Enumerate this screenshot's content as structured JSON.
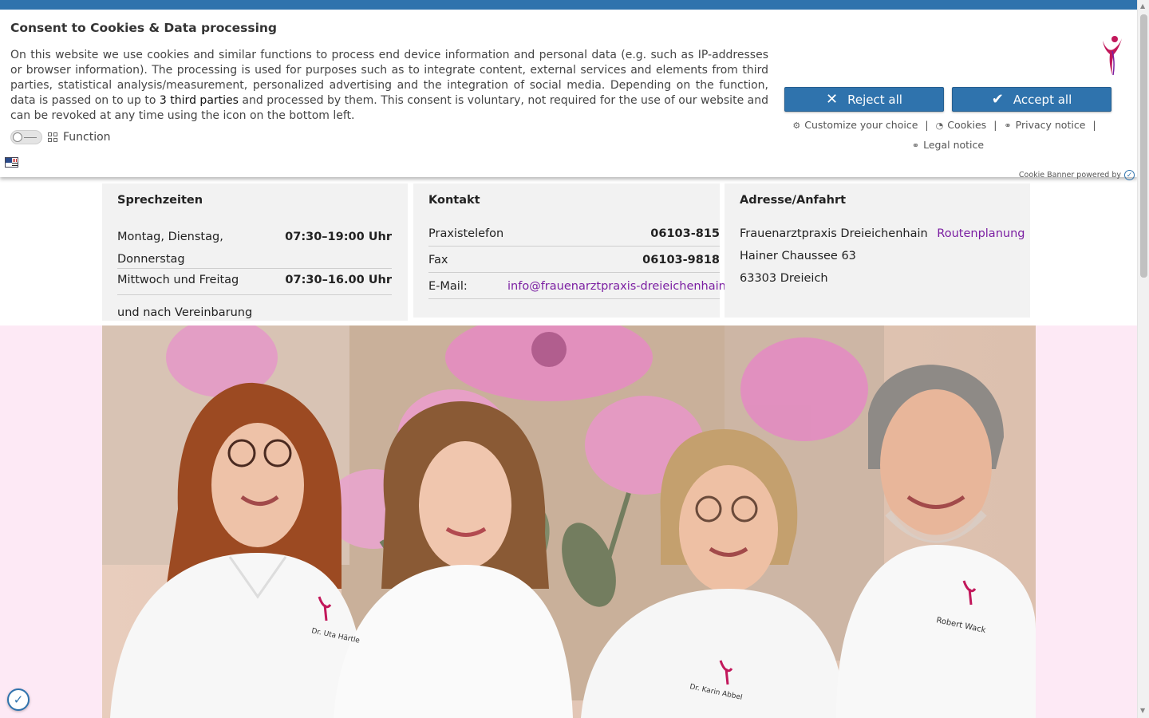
{
  "banner": {
    "title": "Consent to Cookies & Data processing",
    "text_before": "On this website we use cookies and similar functions to process end device information and personal data (e.g. such as IP-addresses or browser information). The processing is used for purposes such as to integrate content, external services and elements from third parties, statistical analysis/measurement, personalized advertising and the integration of social media. Depending on the function, data is passed on to up to ",
    "third_parties": "3 third parties",
    "text_after": " and processed by them. This consent is voluntary, not required for the use of our website and can be revoked at any time using the icon on the bottom left.",
    "function_label": "Function",
    "reject_label": "Reject all",
    "accept_label": "Accept all",
    "links": {
      "customize": "Customize your choice",
      "cookies": "Cookies",
      "privacy": "Privacy notice",
      "legal": "Legal notice",
      "separator": "|"
    },
    "powered_by": "Cookie Banner powered by",
    "accent_color": "#2f73ad"
  },
  "hours": {
    "title": "Sprechzeiten",
    "rows": [
      {
        "label": "Montag, Dienstag,",
        "label2": "Donnerstag",
        "value": "07:30–19:00 Uhr"
      },
      {
        "label": "Mittwoch und Freitag",
        "value": "07:30–16.00 Uhr"
      }
    ],
    "note": "und nach Vereinbarung"
  },
  "contact": {
    "title": "Kontakt",
    "phone_label": "Praxistelefon",
    "phone_value": "06103-815",
    "fax_label": "Fax",
    "fax_value": "06103-9818",
    "email_label": "E-Mail:",
    "email_value": "info@frauenarztpraxis-dreieichenhain"
  },
  "address": {
    "title": "Adresse/Anfahrt",
    "name": "Frauenarztpraxis Dreieichenhain",
    "route_link": "Routenplanung",
    "street": "Hainer Chaussee 63",
    "city": "63303 Dreieich"
  },
  "hero": {
    "shirt_names": [
      "Dr. Uta Härtle",
      "Dr. Karin Abbel",
      "Robert Wack"
    ]
  },
  "icons": {
    "reject": "close-icon",
    "accept": "check-icon",
    "customize": "gear-icon",
    "cookies": "cookie-icon",
    "privacy": "link-icon",
    "legal": "link-icon",
    "language": "flag-icon",
    "consent_fab": "consent-check-icon"
  },
  "colors": {
    "page_pink": "#fde9f5",
    "link_purple": "#7b1fa2",
    "logo_magenta": "#c2185b"
  }
}
